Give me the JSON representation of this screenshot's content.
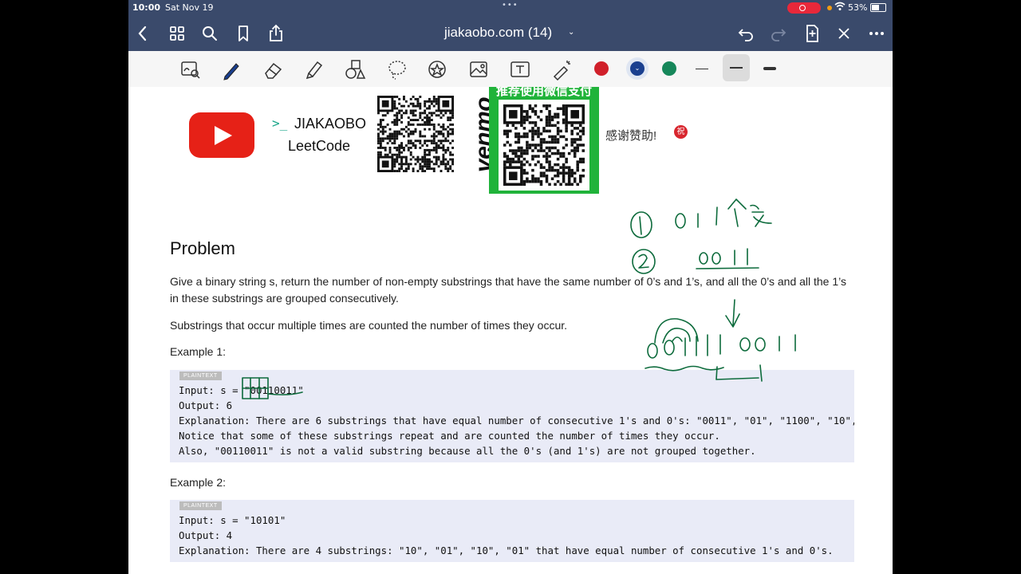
{
  "status_bar": {
    "time": "10:00",
    "date": "Sat Nov 19",
    "battery_percent": "53%",
    "record_color": "#e8283a"
  },
  "nav_bar": {
    "title": "jiakaobo.com (14)",
    "icons": [
      "chevron-left-icon",
      "grid-icon",
      "search-icon",
      "bookmark-icon",
      "share-icon",
      "undo-icon",
      "redo-icon",
      "add-page-icon",
      "close-icon",
      "more-icon"
    ],
    "bg_color": "#3a4a6b"
  },
  "toolbar": {
    "tools": [
      "lasso-zoom-icon",
      "pen-icon",
      "eraser-icon",
      "highlighter-icon",
      "shapes-icon",
      "lasso-icon",
      "sticker-icon",
      "image-icon",
      "text-icon",
      "laser-pointer-icon"
    ],
    "colors": [
      "#d0202a",
      "#1a3f8f",
      "#16875a"
    ],
    "selected_color": "#1a3f8f",
    "strokes": [
      "thin",
      "medium",
      "thick"
    ],
    "selected_stroke": "medium"
  },
  "header_banner": {
    "brand_prompt": ">_",
    "brand_line1": "JIAKAOBO",
    "brand_line2": "LeetCode",
    "venmo": "venmo",
    "wechat_caption": "推荐使用微信支付",
    "thanks": "感谢赞助!",
    "badge": "祝"
  },
  "problem": {
    "title": "Problem",
    "paragraph1": "Give a binary string s, return the number of non-empty substrings that have the same number of 0’s and 1’s, and all the 0’s and all the 1’s in these substrings are grouped consecutively.",
    "paragraph2": "Substrings that occur multiple times are counted the number of times they occur.",
    "example1_label": "Example 1:",
    "example2_label": "Example 2:",
    "code_badge": "PLAINTEXT",
    "example1_lines": [
      "Input: s = \"00110011\"",
      "Output: 6",
      "Explanation: There are 6 substrings that have equal number of consecutive 1's and 0's: \"0011\", \"01\", \"1100\", \"10\", \"0",
      "Notice that some of these substrings repeat and are counted the number of times they occur.",
      "Also, \"00110011\" is not a valid substring because all the 0's (and 1's) are not grouped together."
    ],
    "example2_lines": [
      "Input: s = \"10101\"",
      "Output: 4",
      "Explanation: There are 4 substrings: \"10\", \"01\", \"10\", \"01\" that have equal number of consecutive 1's and 0's."
    ]
  },
  "ink_color": "#0d6b3c"
}
